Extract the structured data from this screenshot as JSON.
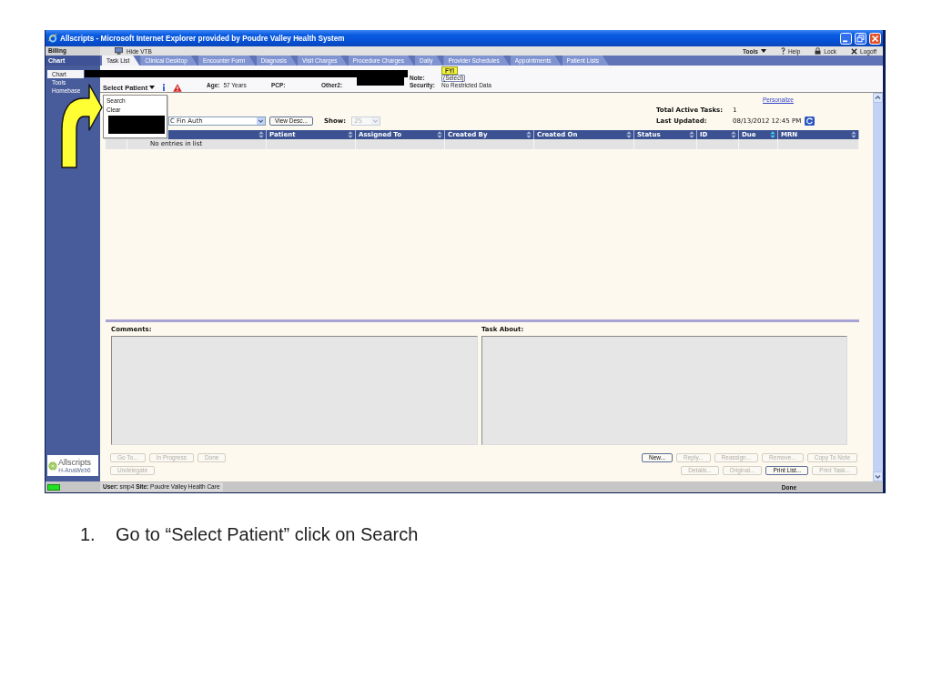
{
  "window": {
    "title": "Allscripts - Microsoft Internet Explorer provided by Poudre Valley Health System"
  },
  "top_bar": {
    "module": "Billing",
    "hide_button": "Hide VTB",
    "links": [
      {
        "label": "Tools",
        "kind": "menu"
      },
      {
        "label": "Help",
        "kind": "help"
      },
      {
        "label": "Lock",
        "kind": "lock"
      },
      {
        "label": "Logoff",
        "kind": "logoff"
      }
    ]
  },
  "sidebar": {
    "header": "Chart",
    "items": [
      {
        "label": "Chart",
        "selected": true
      },
      {
        "label": "Tools",
        "selected": false
      },
      {
        "label": "Homebase",
        "selected": false
      }
    ],
    "logo": {
      "name": "Allscripts",
      "subtitle": "H-AnaWeb6"
    }
  },
  "tabs": [
    {
      "label": "Task List",
      "selected": true
    },
    {
      "label": "Clinical Desktop",
      "selected": false
    },
    {
      "label": "Encounter Form",
      "selected": false
    },
    {
      "label": "Diagnosis",
      "selected": false
    },
    {
      "label": "Visit Charges",
      "selected": false
    },
    {
      "label": "Procedure Charges",
      "selected": false
    },
    {
      "label": "Daily",
      "selected": false
    },
    {
      "label": "Provider Schedules",
      "selected": false
    },
    {
      "label": "Appointments",
      "selected": false
    },
    {
      "label": "Patient Lists",
      "selected": false
    }
  ],
  "patient_banner": {
    "select_label": "Select Patient",
    "columns": [
      {
        "fields": [
          {
            "kind": "text",
            "label": "Age:",
            "value": "57 Years"
          }
        ]
      },
      {
        "fields": [
          {
            "kind": "text",
            "label": "PCP:"
          }
        ]
      },
      {
        "fields": [
          {
            "kind": "text",
            "label": "Other2:"
          }
        ]
      },
      {
        "fields": [
          {
            "kind": "badge",
            "value": "FYI"
          },
          {
            "kind": "link",
            "label": "Note:",
            "value": "(Select)"
          },
          {
            "kind": "text",
            "label": "Security:",
            "value": "No Restricted Data"
          }
        ]
      }
    ]
  },
  "patient_menu": {
    "items": [
      {
        "label": "Search"
      },
      {
        "label": "Clear"
      }
    ]
  },
  "task_list": {
    "personalize_link": "Personalize",
    "total_label": "Total Active Tasks:",
    "total_value": "1",
    "updated_label": "Last Updated:",
    "updated_value": "08/13/2012 12:45 PM",
    "filter_value": "C Fin Auth",
    "view_button": "View Desc...",
    "show_label": "Show:",
    "show_value": "25",
    "show_disabled": true,
    "columns": [
      {
        "sorted": false
      },
      {
        "label": "Patient",
        "sorted": false
      },
      {
        "label": "Assigned To",
        "sorted": false
      },
      {
        "label": "Created By",
        "sorted": false
      },
      {
        "label": "Created On",
        "sorted": false
      },
      {
        "label": "Status",
        "sorted": false
      },
      {
        "label": "ID",
        "sorted": false
      },
      {
        "label": "Due",
        "sorted": true
      },
      {
        "label": "MRN",
        "sorted": false
      }
    ],
    "empty_message": "No entries in list"
  },
  "details": {
    "comments_label": "Comments:",
    "task_about_label": "Task About:"
  },
  "left_buttons": [
    {
      "buttons": [
        {
          "label": "Go To...",
          "disabled": true
        },
        {
          "label": "In Progress",
          "disabled": true
        },
        {
          "label": "Done",
          "disabled": true
        }
      ]
    },
    {
      "buttons": [
        {
          "label": "Undelegate",
          "disabled": true
        }
      ]
    }
  ],
  "right_buttons": [
    {
      "buttons": [
        {
          "label": "New...",
          "disabled": false
        },
        {
          "label": "Reply...",
          "disabled": true
        },
        {
          "label": "Reassign...",
          "disabled": true
        },
        {
          "label": "Remove...",
          "disabled": true
        },
        {
          "label": "Copy To Note",
          "disabled": true
        }
      ]
    },
    {
      "buttons": [
        {
          "label": "Details...",
          "disabled": true
        },
        {
          "label": "Original...",
          "disabled": true
        },
        {
          "label": "Print List...",
          "disabled": false
        },
        {
          "label": "Print Task...",
          "disabled": true
        }
      ]
    }
  ],
  "status_bar": {
    "text": "**User:** smp4 **Site:** Poudre Valley Health Care",
    "status": "Done"
  },
  "instructions": [
    {
      "number": "1.",
      "text": "Go to “Select Patient” click on Search"
    }
  ]
}
